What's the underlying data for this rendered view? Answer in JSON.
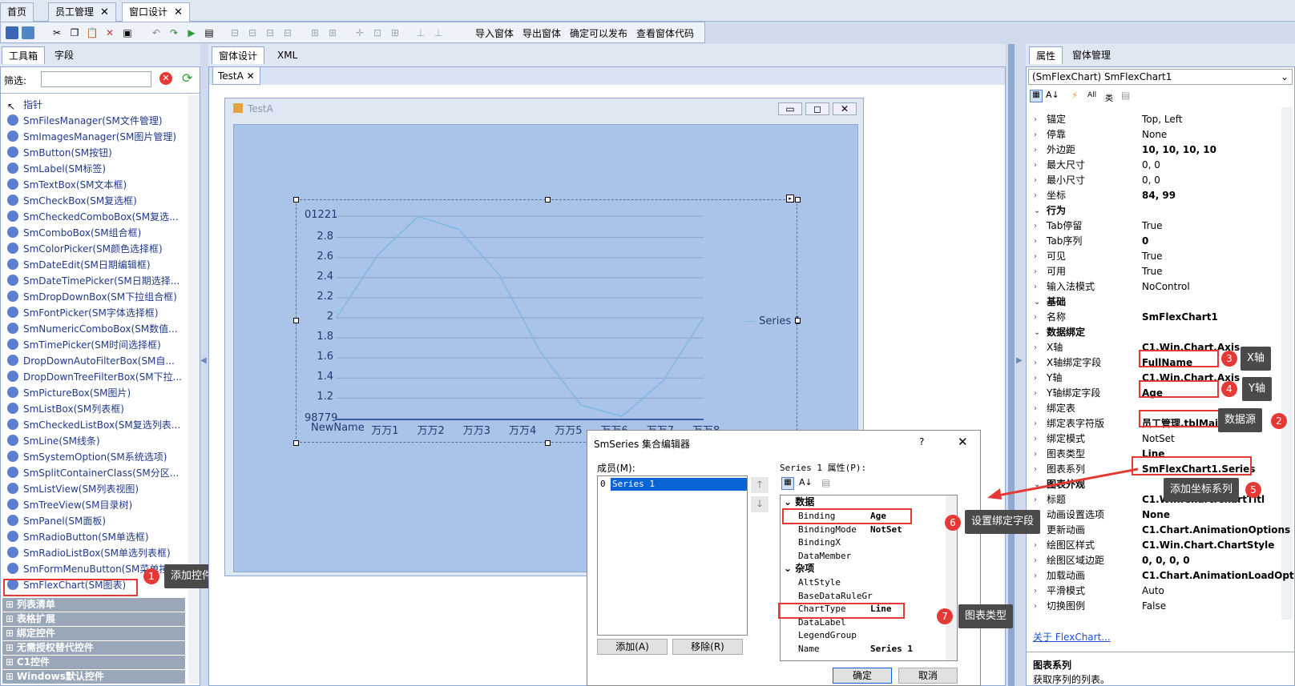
{
  "doc_tabs": [
    {
      "label": "首页"
    },
    {
      "label": "员工管理"
    },
    {
      "label": "窗口设计"
    }
  ],
  "toolbar": {
    "import_form": "导入窗体",
    "export_form": "导出窗体",
    "publish": "确定可以发布",
    "view_code": "查看窗体代码"
  },
  "toolbox": {
    "tab_toolbox": "工具箱",
    "tab_fields": "字段",
    "filter_label": "筛选:",
    "filter_value": "",
    "items": [
      "指针",
      "SmFilesManager(SM文件管理)",
      "SmImagesManager(SM图片管理)",
      "SmButton(SM按钮)",
      "SmLabel(SM标签)",
      "SmTextBox(SM文本框)",
      "SmCheckBox(SM复选框)",
      "SmCheckedComboBox(SM复选...",
      "SmComboBox(SM组合框)",
      "SmColorPicker(SM颜色选择框)",
      "SmDateEdit(SM日期编辑框)",
      "SmDateTimePicker(SM日期选择...",
      "SmDropDownBox(SM下拉组合框)",
      "SmFontPicker(SM字体选择框)",
      "SmNumericComboBox(SM数值...",
      "SmTimePicker(SM时间选择框)",
      "DropDownAutoFilterBox(SM自...",
      "DropDownTreeFilterBox(SM下拉...",
      "SmPictureBox(SM图片)",
      "SmListBox(SM列表框)",
      "SmCheckedListBox(SM复选列表...",
      "SmLine(SM线条)",
      "SmSystemOption(SM系统选项)",
      "SmSplitContainerClass(SM分区...",
      "SmListView(SM列表视图)",
      "SmTreeView(SM目录树)",
      "SmPanel(SM面板)",
      "SmRadioButton(SM单选框)",
      "SmRadioListBox(SM单选列表框)",
      "SmFormMenuButton(SM菜单按",
      "SmFlexChart(SM图表)"
    ],
    "categories": [
      "列表清单",
      "表格扩展",
      "绑定控件",
      "无需授权替代控件",
      "C1控件",
      "Windows默认控件"
    ]
  },
  "designer": {
    "tab_design": "窗体设计",
    "tab_xml": "XML",
    "doc_tab": "TestA",
    "form_title": "TestA"
  },
  "chart_data": {
    "type": "line",
    "categories": [
      "NewName",
      "万万1",
      "万万2",
      "万万3",
      "万万4",
      "万万5",
      "万万6",
      "万万7",
      "万万8"
    ],
    "series": [
      {
        "name": "Series 1",
        "values": [
          2.0,
          2.62,
          3.01,
          2.88,
          2.42,
          1.66,
          1.13,
          1.02,
          1.37,
          2.0
        ]
      }
    ],
    "ytick_labels": [
      "01221",
      "2.8",
      "2.6",
      "2.4",
      "2.2",
      "2",
      "1.8",
      "1.6",
      "1.4",
      "1.2",
      "98779"
    ],
    "yticks": [
      3.01221,
      2.8,
      2.6,
      2.4,
      2.2,
      2.0,
      1.8,
      1.6,
      1.4,
      1.2,
      0.98779
    ],
    "ylim": [
      0.98779,
      3.01221
    ],
    "legend": "right",
    "color": "#7fb7e6"
  },
  "properties": {
    "tab_props": "属性",
    "tab_form_mgr": "窗体管理",
    "object": "(SmFlexChart) SmFlexChart1",
    "rows": [
      {
        "k": "锚定",
        "v": "Top, Left"
      },
      {
        "k": "停靠",
        "v": "None"
      },
      {
        "k": "外边距",
        "v": "10, 10, 10, 10",
        "bold": true
      },
      {
        "k": "最大尺寸",
        "v": "0, 0"
      },
      {
        "k": "最小尺寸",
        "v": "0, 0"
      },
      {
        "k": "坐标",
        "v": "84, 99",
        "bold": true
      },
      {
        "k": "行为",
        "v": "",
        "sect": true
      },
      {
        "k": "Tab停留",
        "v": "True"
      },
      {
        "k": "Tab序列",
        "v": "0",
        "bold": true
      },
      {
        "k": "可见",
        "v": "True"
      },
      {
        "k": "可用",
        "v": "True"
      },
      {
        "k": "输入法模式",
        "v": "NoControl"
      },
      {
        "k": "基础",
        "v": "",
        "sect": true
      },
      {
        "k": "名称",
        "v": "SmFlexChart1",
        "bold": true
      },
      {
        "k": "数据绑定",
        "v": "",
        "sect": true
      },
      {
        "k": "X轴",
        "v": "C1.Win.Chart.Axis",
        "bold": true
      },
      {
        "k": "X轴绑定字段",
        "v": "FullName",
        "bold": true
      },
      {
        "k": "Y轴",
        "v": "C1.Win.Chart.Axis",
        "bold": true
      },
      {
        "k": "Y轴绑定字段",
        "v": "Age",
        "bold": true
      },
      {
        "k": "绑定表",
        "v": ""
      },
      {
        "k": "绑定表字符版",
        "v": "员工管理.tblMain",
        "bold": true
      },
      {
        "k": "绑定模式",
        "v": "NotSet"
      },
      {
        "k": "图表类型",
        "v": "Line",
        "bold": true
      },
      {
        "k": "图表系列",
        "v": "SmFlexChart1.Series",
        "bold": true
      },
      {
        "k": "图表外观",
        "v": "",
        "sect": true
      },
      {
        "k": "标题",
        "v": "C1.Win.Chart.ChartTitl",
        "bold": true
      },
      {
        "k": "动画设置选项",
        "v": "None",
        "bold": true
      },
      {
        "k": "更新动画",
        "v": "C1.Chart.AnimationOptions",
        "bold": true
      },
      {
        "k": "绘图区样式",
        "v": "C1.Win.Chart.ChartStyle",
        "bold": true
      },
      {
        "k": "绘图区域边距",
        "v": "0, 0, 0, 0",
        "bold": true
      },
      {
        "k": "加载动画",
        "v": "C1.Chart.AnimationLoadOpt",
        "bold": true
      },
      {
        "k": "平滑模式",
        "v": "Auto"
      },
      {
        "k": "切换图例",
        "v": "False"
      }
    ],
    "link": "关于 FlexChart...",
    "desc_title": "图表系列",
    "desc_text": "获取序列的列表。"
  },
  "callouts": {
    "c1": "添加控件",
    "c2": "数据源",
    "c3": "X轴",
    "c4": "Y轴",
    "c5": "添加坐标系列",
    "c6": "设置绑定字段",
    "c7": "图表类型",
    "n1": "1",
    "n2": "2",
    "n3": "3",
    "n4": "4",
    "n5": "5",
    "n6": "6",
    "n7": "7"
  },
  "dialog": {
    "title": "SmSeries 集合编辑器",
    "help": "?",
    "members_label": "成员(M):",
    "member_index": "0",
    "member": "Series 1",
    "props_label": "Series 1 属性(P):",
    "sections": [
      {
        "name": "数据",
        "rows": [
          {
            "k": "Binding",
            "v": "Age"
          },
          {
            "k": "BindingMode",
            "v": "NotSet"
          },
          {
            "k": "BindingX",
            "v": ""
          },
          {
            "k": "DataMember",
            "v": ""
          }
        ]
      },
      {
        "name": "杂项",
        "rows": [
          {
            "k": "AltStyle",
            "v": ""
          },
          {
            "k": "BaseDataRuleGr",
            "v": ""
          },
          {
            "k": "ChartType",
            "v": "Line"
          },
          {
            "k": "DataLabel",
            "v": ""
          },
          {
            "k": "LegendGroup",
            "v": ""
          },
          {
            "k": "Name",
            "v": "Series 1"
          }
        ]
      }
    ],
    "add": "添加(A)",
    "remove": "移除(R)",
    "ok": "确定",
    "cancel": "取消"
  }
}
